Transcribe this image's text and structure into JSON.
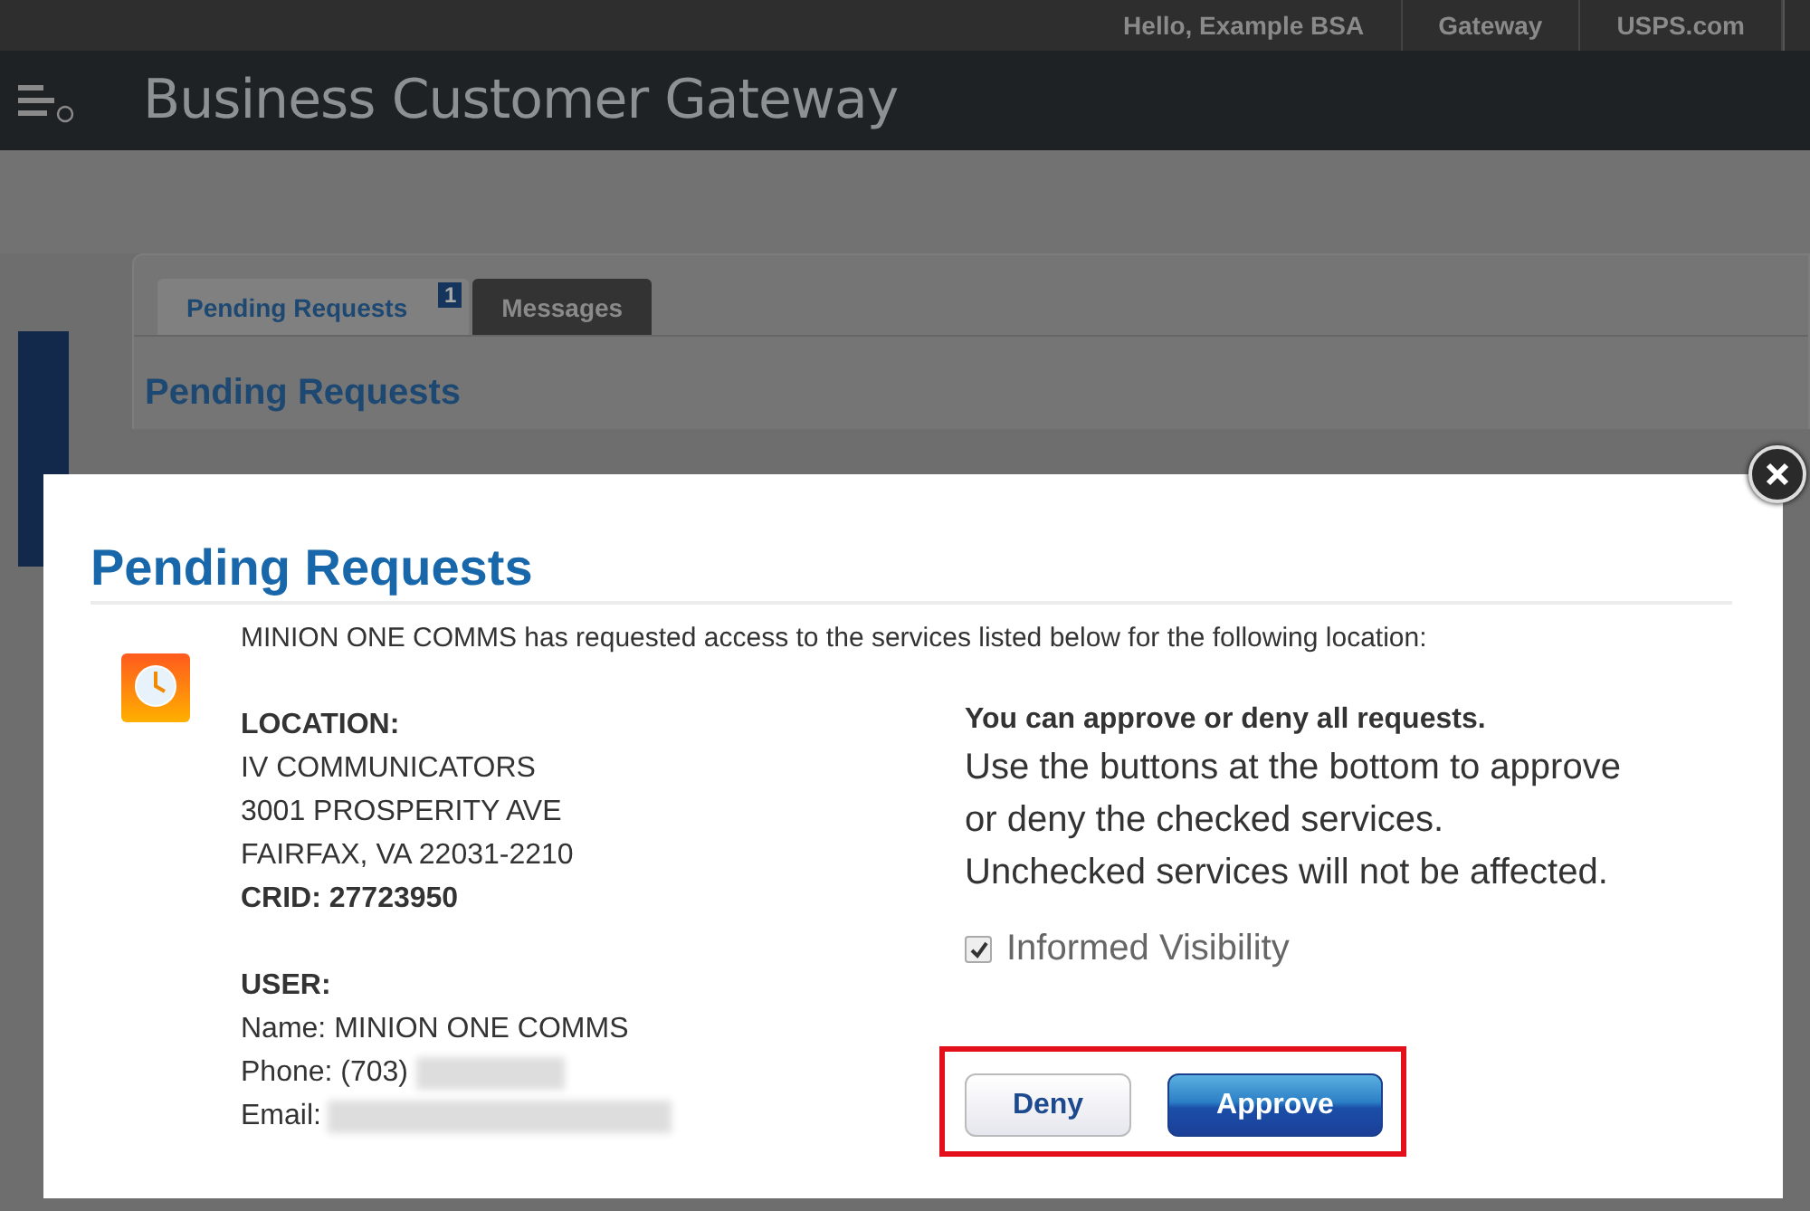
{
  "top_bar": {
    "links": [
      "Hello, Example BSA",
      "Gateway",
      "USPS.com"
    ]
  },
  "header": {
    "title": "Business Customer Gateway"
  },
  "tabs": [
    {
      "label": "Pending Requests",
      "selected": true,
      "badge": "1"
    },
    {
      "label": "Messages",
      "selected": false
    }
  ],
  "page_heading": "Pending Requests",
  "dialog": {
    "title": "Pending Requests",
    "intro": "MINION ONE COMMS has requested access to the services listed below for the following location:",
    "location": {
      "heading": "LOCATION:",
      "lines": [
        "IV COMMUNICATORS",
        "3001 PROSPERITY AVE",
        "FAIRFAX, VA 22031-2210"
      ],
      "crid": "CRID: 27723950"
    },
    "user": {
      "heading": "USER:",
      "name": "Name: MINION ONE COMMS",
      "phone": "Phone: (703)",
      "email": "Email:"
    },
    "notice": {
      "heading": "You can approve or deny all requests.",
      "lines": [
        "Use the buttons at the bottom to approve",
        "or deny the checked services.",
        "Unchecked services will not be affected."
      ]
    },
    "services": [
      {
        "label": "Informed Visibility",
        "checked": true
      }
    ],
    "buttons": [
      {
        "label": "Deny",
        "kind": "secondary"
      },
      {
        "label": "Approve",
        "kind": "primary"
      }
    ],
    "highlighted": true
  }
}
